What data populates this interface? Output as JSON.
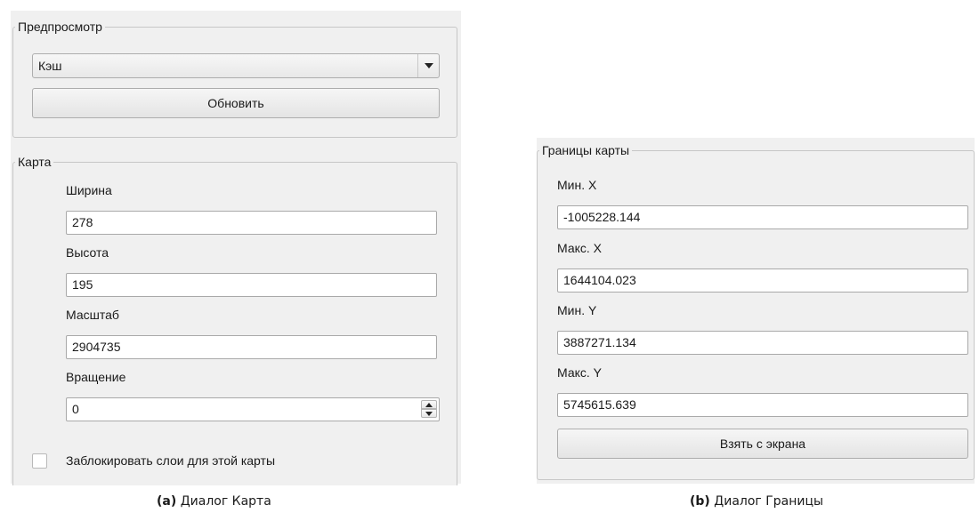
{
  "dialog_map": {
    "preview_group": {
      "title": "Предпросмотр",
      "combo_value": "Кэш",
      "refresh_button": "Обновить"
    },
    "map_group": {
      "title": "Карта",
      "width_label": "Ширина",
      "width_value": "278",
      "height_label": "Высота",
      "height_value": "195",
      "scale_label": "Масштаб",
      "scale_value": "2904735",
      "rotation_label": "Вращение",
      "rotation_value": "0",
      "lock_layers_label": "Заблокировать слои для этой карты",
      "lock_layers_checked": false
    },
    "caption_prefix": "(a)",
    "caption_text": "Диалог Карта"
  },
  "dialog_bounds": {
    "group": {
      "title": "Границы карты",
      "min_x_label": "Мин. X",
      "min_x_value": "-1005228.144",
      "max_x_label": "Макс. X",
      "max_x_value": "1644104.023",
      "min_y_label": "Мин. Y",
      "min_y_value": "3887271.134",
      "max_y_label": "Макс. Y",
      "max_y_value": "5745615.639",
      "from_screen_button": "Взять с экрана"
    },
    "caption_prefix": "(b)",
    "caption_text": "Диалог Границы"
  }
}
